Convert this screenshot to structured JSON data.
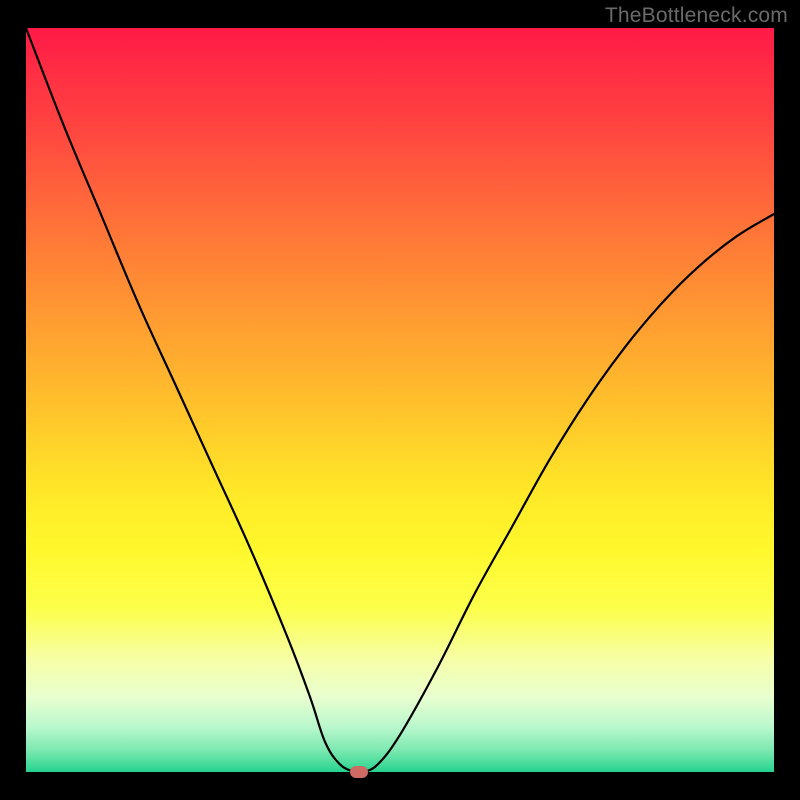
{
  "watermark": "TheBottleneck.com",
  "chart_data": {
    "type": "line",
    "title": "",
    "xlabel": "",
    "ylabel": "",
    "xlim": [
      0,
      100
    ],
    "ylim": [
      0,
      100
    ],
    "grid": false,
    "legend": false,
    "series": [
      {
        "name": "bottleneck-curve",
        "x": [
          0,
          5,
          10,
          15,
          20,
          25,
          30,
          35,
          38,
          40,
          42,
          44,
          45,
          47,
          50,
          55,
          60,
          65,
          70,
          75,
          80,
          85,
          90,
          95,
          100
        ],
        "y": [
          100,
          87,
          75,
          63,
          52,
          41,
          30,
          18,
          10,
          4,
          1,
          0,
          0,
          1,
          5,
          14,
          24,
          33,
          42,
          50,
          57,
          63,
          68,
          72,
          75
        ]
      }
    ],
    "marker": {
      "x": 44.5,
      "y": 0
    },
    "background_gradient": {
      "top": "#ff1a47",
      "mid": "#ffe728",
      "bottom": "#24d18e"
    }
  }
}
